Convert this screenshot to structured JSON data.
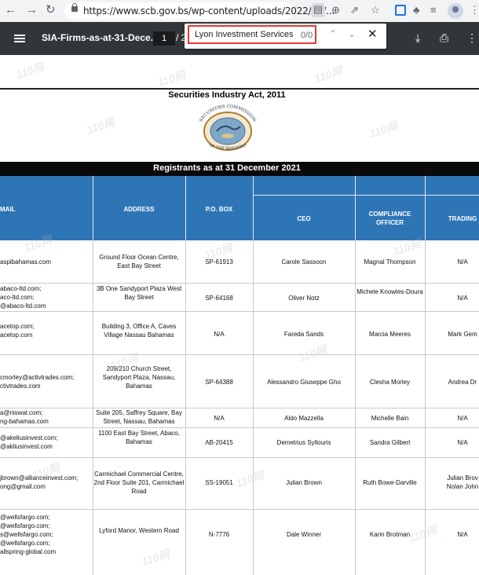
{
  "browser": {
    "url": "https://www.scb.gov.bs/wp-content/uploads/2022/01/..."
  },
  "pdf_toolbar": {
    "title": "SIA-Firms-as-at-31-Dece...",
    "page_current": "1",
    "page_separator": "/ 2"
  },
  "find_bar": {
    "query": "Lyon Investment Services",
    "count": "0/0"
  },
  "document": {
    "act_title": "Securities Industry Act, 2011",
    "seal_text_top": "SECURITIES COMMISSION",
    "seal_text_bottom": "OF THE BAHAMAS",
    "registrants_title": "Registrants as at 31 December 2021",
    "headers": {
      "email": "MAIL",
      "address": "ADDRESS",
      "po_box": "P.O. BOX",
      "ceo": "CEO",
      "compliance": "COMPLIANCE OFFICER",
      "trading": "TRADING"
    },
    "watermark": "110网",
    "rows": [
      {
        "email": "aspibahamas.com",
        "address": "Ground Floor Ocean Centre, East Bay Street",
        "po_box": "SP-61913",
        "ceo": "Carole Sassoon",
        "compliance": "Magnal Thompson",
        "trading": "N/A"
      },
      {
        "email": "abaco-ltd.com;\naco-ltd.com;\n@abaco-ltd.com",
        "address": "3B One Sandyport Plaza West Bay Street",
        "po_box": "SP-64168",
        "ceo": "Oliver Notz",
        "compliance": "Michele Knowles-Doura",
        "trading": "N/A"
      },
      {
        "email": "acetop.com;\nacetop.com",
        "address": "Building 3, Office A, Caves Village Nassau Bahamas",
        "po_box": "N/A",
        "ceo": "Fareda Sands",
        "compliance": "Marcia Meeres",
        "trading": "Mark Gem"
      },
      {
        "email": "cmorley@activtrades.com;\nctivtrades.com",
        "address": "209/210 Church Street, Sandyport Plaza, Nassau, Bahamas",
        "po_box": "SP-64388",
        "ceo": "Alessandro Giuseppe Gho",
        "compliance": "Clesha Morley",
        "trading": "Andrea Dr"
      },
      {
        "email": "a@niswal.com;\nng-bahamas.com",
        "address": "Suite 205, Saffrey Square, Bay Street, Nassau, Bahamas",
        "po_box": "N/A",
        "ceo": "Aldo Mazzella",
        "compliance": "Michelle Bain",
        "trading": "N/A"
      },
      {
        "email": "@akeliusinvest.com;\n@akliusinvest.com",
        "address": "1100 East Bay Street, Abaco, Bahamas",
        "po_box": "AB-20415",
        "ceo": "Demetrius Syllouris",
        "compliance": "Sandra Gilbert",
        "trading": "N/A"
      },
      {
        "email": "jbrown@allianceinvest.com;\nong@gmail.com",
        "address": "Carmichael Commercial Centre, 2nd Floor Suite 201, Carmichael Road",
        "po_box": "SS-19051",
        "ceo": "Julian Brown",
        "compliance": "Ruth Bowe-Darville",
        "trading": "Julian Brov\nNolan John"
      },
      {
        "email": "@wellsfargo.com;\n@wellsfargo.com;\ns@wellsfargo.com;\n@wellsfargo.com;\nallspring-global.com",
        "address": "Lyford Manor, Western Road",
        "po_box": "N-7776",
        "ceo": "Dale Winner",
        "compliance": "Karin Brotman",
        "trading": "N/A"
      }
    ]
  }
}
